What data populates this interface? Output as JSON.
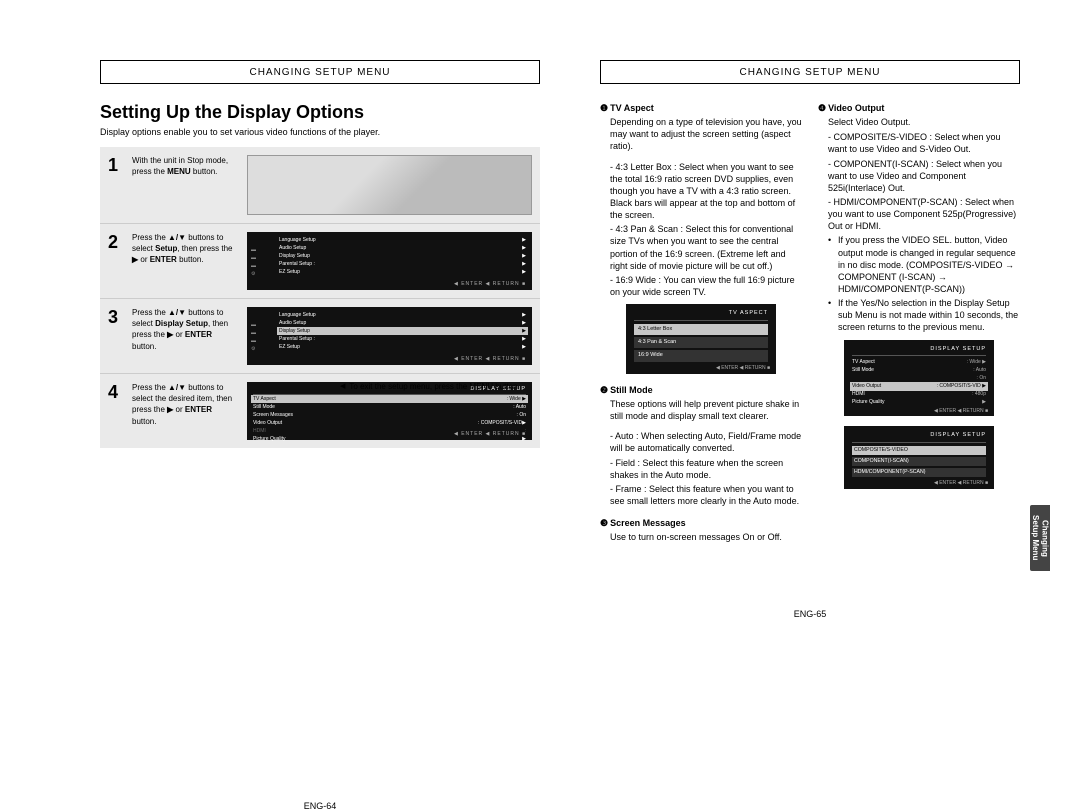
{
  "left": {
    "header": "CHANGING SETUP MENU",
    "title": "Setting Up the Display Options",
    "intro": "Display options enable you to set various video functions of the player.",
    "steps": {
      "s1": {
        "num": "1",
        "desc_a": "With the unit in Stop mode, press the ",
        "desc_b": "MENU",
        "desc_c": " button."
      },
      "s2": {
        "num": "2",
        "desc_a": "Press the ",
        "desc_b": "▲/▼",
        "desc_c": " buttons to select ",
        "desc_d": "Setup",
        "desc_e": ", then press the ",
        "desc_f": "▶",
        "desc_g": " or ",
        "desc_h": "ENTER",
        "desc_i": " button."
      },
      "s3": {
        "num": "3",
        "desc_a": "Press the ",
        "desc_b": "▲/▼",
        "desc_c": " buttons to select ",
        "desc_d": "Display Setup",
        "desc_e": ", then press the ",
        "desc_f": "▶",
        "desc_g": " or ",
        "desc_h": "ENTER",
        "desc_i": " button."
      },
      "s4": {
        "num": "4",
        "desc_a": "Press the ",
        "desc_b": "▲/▼",
        "desc_c": " buttons to select the desired item, then press the ",
        "desc_f": "▶",
        "desc_g": " or ",
        "desc_h": "ENTER",
        "desc_i": " button."
      }
    },
    "exit": "To exit the setup menu, press the MENU button.",
    "pagenum": "ENG-64",
    "menu_list": {
      "lang": "Language Setup",
      "audio": "Audio Setup",
      "display": "Display Setup",
      "parental": "Parental Setup :",
      "ez": "EZ Setup",
      "foot": "◀ ENTER   ◀ RETURN   ■"
    },
    "menu4": {
      "title": "DISPLAY SETUP",
      "r1a": "TV Aspect",
      "r1b": ": Wide",
      "arrow": "▶",
      "r2a": "Still Mode",
      "r2b": ": Auto",
      "r3a": "Screen Messages",
      "r3b": ": On",
      "r4a": "Video Output",
      "r4b": ": COMPOSIT/S-VID",
      "r5a": "HDMI",
      "r5b": ": ",
      "r6a": "Picture Quality",
      "r6b": "",
      "foot": "◀ ENTER   ◀ RETURN   ■"
    }
  },
  "right": {
    "header": "CHANGING SETUP MENU",
    "pagenum": "ENG-65",
    "opt1": {
      "num": "❶",
      "title": "TV Aspect",
      "intro": "Depending on a type of television you have, you may want to adjust the screen setting (aspect ratio).",
      "a": "- 4:3 Letter Box : Select when you want to see the total 16:9 ratio screen DVD supplies, even though you have a TV with a 4:3 ratio screen. Black bars will appear at the top and bottom of the screen.",
      "b": "- 4:3 Pan & Scan : Select this for conventional size TVs when you want to see the central portion of the 16:9 screen. (Extreme left and right side of movie picture will be cut off.)",
      "c": "- 16:9 Wide : You can view the full 16:9 picture on your wide screen TV.",
      "menu_title": "TV ASPECT",
      "m1": "4:3 Letter Box",
      "m2": "4:3 Pan & Scan",
      "m3": "16:9 Wide"
    },
    "opt2": {
      "num": "❷",
      "title": "Still Mode",
      "intro": "These options will help prevent picture shake in still mode and display small text clearer.",
      "a": "- Auto : When selecting Auto, Field/Frame mode will be automatically converted.",
      "b": "- Field : Select this feature when the screen shakes in the Auto mode.",
      "c": "- Frame : Select this feature when you want to see small letters more clearly in the Auto mode."
    },
    "opt3": {
      "num": "❸",
      "title": "Screen Messages",
      "intro": "Use to turn on-screen messages On or Off."
    },
    "opt4": {
      "num": "❹",
      "title": "Video Output",
      "intro": "Select Video Output.",
      "a": "- COMPOSITE/S-VIDEO : Select when you want to use Video and S-Video Out.",
      "b": "- COMPONENT(I-SCAN) : Select when you want to use Video and Component 525i(Interlace) Out.",
      "c": "- HDMI/COMPONENT(P-SCAN) : Select when you want to use Component 525p(Progressive) Out or HDMI.",
      "n1": "If you press the VIDEO SEL. button, Video output mode is changed in regular sequence in no disc mode. (COMPOSITE/S-VIDEO → COMPONENT (I-SCAN) → HDMI/COMPONENT(P-SCAN))",
      "n2": "If the Yes/No selection in the Display Setup sub Menu is not made within 10 seconds, the screen returns to the previous menu.",
      "menu2_title": "DISPLAY SETUP",
      "m2_1a": "TV Aspect",
      "m2_1b": ": Wide",
      "m2_2a": "Still Mode",
      "m2_2b": ": Auto",
      "m2_3a": "Screen Messages",
      "m2_3b": ": On",
      "m2_4a": "Video Output",
      "m2_4b": ": COMPOSIT/S-VID",
      "m2_5a": "HDMI",
      "m2_5b": ": 480p",
      "m2_6a": "Picture Quality",
      "m2_6b": "",
      "menu3_title": "DISPLAY SETUP",
      "m3_1": "COMPOSITE/S-VIDEO",
      "m3_2": "COMPONENT(I-SCAN)",
      "m3_3": "HDMI/COMPONENT(P-SCAN)",
      "foot": "◀ ENTER   ◀ RETURN   ■"
    },
    "sidetab1": "Changing",
    "sidetab2": "Setup Menu"
  }
}
